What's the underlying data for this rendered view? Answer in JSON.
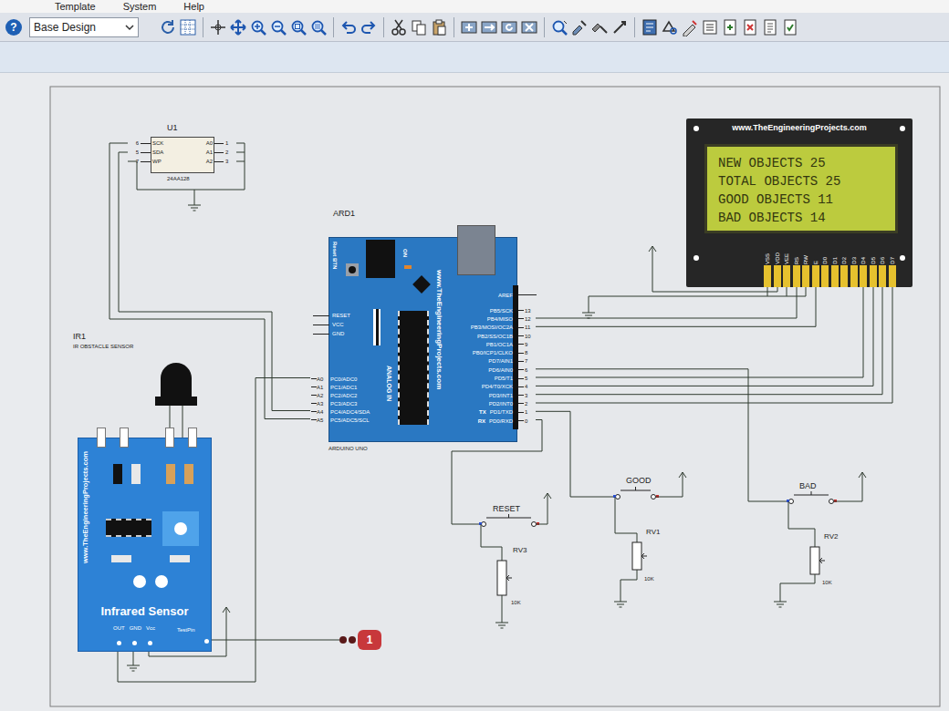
{
  "menu": [
    {
      "label": "Template"
    },
    {
      "label": "System"
    },
    {
      "label": "Help"
    }
  ],
  "toolbar": {
    "help": "?",
    "design": "Base Design"
  },
  "eeprom": {
    "ref": "U1",
    "part": "24AA128",
    "left_pins": [
      {
        "num": "6",
        "name": "SCK"
      },
      {
        "num": "5",
        "name": "SDA"
      },
      {
        "num": "7",
        "name": "WP"
      }
    ],
    "right_pins": [
      {
        "name": "A0",
        "num": "1"
      },
      {
        "name": "A1",
        "num": "2"
      },
      {
        "name": "A2",
        "num": "3"
      }
    ]
  },
  "arduino": {
    "ref": "ARD1",
    "label": "ARDUINO UNO",
    "reset_btn": "Reset BTN",
    "on": "ON",
    "url": "www.TheEngineeringProjects.com",
    "analog_in": "ANALOG IN",
    "aref": "AREF",
    "power_pins": [
      {
        "name": "RESET"
      },
      {
        "name": "VCC"
      },
      {
        "name": "GND"
      }
    ],
    "analog_pins": [
      {
        "num": "A0",
        "name": "PC0/ADC0"
      },
      {
        "num": "A1",
        "name": "PC1/ADC1"
      },
      {
        "num": "A2",
        "name": "PC2/ADC2"
      },
      {
        "num": "A3",
        "name": "PC3/ADC3"
      },
      {
        "num": "A4",
        "name": "PC4/ADC4/SDA"
      },
      {
        "num": "A5",
        "name": "PC5/ADC5/SCL"
      }
    ],
    "digital_pins": [
      {
        "name": "PB5/SCK",
        "num": "13"
      },
      {
        "name": "PB4/MISO",
        "num": "12"
      },
      {
        "name": "PB3/MOSI/OC2A",
        "num": "11"
      },
      {
        "name": "PB2/SS/OC1B",
        "num": "10"
      },
      {
        "name": "PB1/OC1A",
        "num": "9"
      },
      {
        "name": "PB0/ICP1/CLKO",
        "num": "8"
      },
      {
        "name": "PD7/AIN1",
        "num": "7"
      },
      {
        "name": "PD6/AIN0",
        "num": "6"
      },
      {
        "name": "PD5/T1",
        "num": "5"
      },
      {
        "name": "PD4/T0/XCK",
        "num": "4"
      },
      {
        "name": "PD3/INT1",
        "num": "3"
      },
      {
        "name": "PD2/INT0",
        "num": "2"
      },
      {
        "name": "PD1/TXD",
        "num": "1",
        "tag": "TX"
      },
      {
        "name": "PD0/RXD",
        "num": "0",
        "tag": "RX"
      }
    ]
  },
  "lcd": {
    "url": "www.TheEngineeringProjects.com",
    "lines": [
      "NEW OBJECTS 25",
      "TOTAL OBJECTS 25",
      "GOOD OBJECTS 11",
      "BAD OBJECTS 14"
    ],
    "pins": [
      "VSS",
      "VDD",
      "VEE",
      "RS",
      "RW",
      "E",
      "D0",
      "D1",
      "D2",
      "D3",
      "D4",
      "D5",
      "D6",
      "D7"
    ]
  },
  "ir_sensor": {
    "ref": "IR1",
    "label": "IR OBSTACLE SENSOR",
    "url": "www.TheEngineeringProjects.com",
    "title": "Infrared Sensor",
    "pins": [
      "OUT",
      "GND",
      "Vcc"
    ],
    "test_pin": "TestPin"
  },
  "buttons": [
    {
      "label": "RESET",
      "pot": "RV3",
      "value": "10K"
    },
    {
      "label": "GOOD",
      "pot": "RV1",
      "value": "10K"
    },
    {
      "label": "BAD",
      "pot": "RV2",
      "value": "10K"
    }
  ],
  "logic_state": {
    "value": "1"
  }
}
